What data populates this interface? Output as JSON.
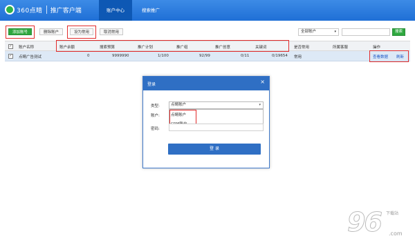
{
  "header": {
    "brand": "360点睛",
    "subtitle": "推广客户端",
    "tabs": [
      {
        "label": "账户中心",
        "active": true
      },
      {
        "label": "搜索推广",
        "active": false
      }
    ]
  },
  "toolbar": {
    "add_account": "添加账号",
    "delete_account": "删除账户",
    "set_common": "设为常用",
    "cancel_common": "取消常用",
    "filter_select": "全部账户",
    "search_value": "",
    "search_button": "搜索"
  },
  "table": {
    "headers": [
      "账户名称",
      "账户余额",
      "搜索预算",
      "推广计划",
      "推广组",
      "推广创意",
      "关键词",
      "是否常用",
      "所属客服",
      "操作"
    ],
    "rows": [
      {
        "checked": true,
        "name": "点睛广告测试",
        "balance": "0",
        "budget": "9999990",
        "plans": "1/100",
        "groups": "92/99",
        "creatives": "0/11",
        "keywords": "0/19654",
        "common": "常用",
        "service": "",
        "action_view": "查看数据",
        "action_refresh": "刷新"
      }
    ]
  },
  "login_dialog": {
    "title": "登录",
    "close": "×",
    "type_label": "类型:",
    "type_value": "点睛账户",
    "options": [
      "点睛账户",
      "CRM账户"
    ],
    "account_label": "账户:",
    "password_label": "密码:",
    "login_button": "登 录"
  },
  "watermark": {
    "number": "96",
    "sub": "下载站",
    "domain": ".com"
  },
  "colors": {
    "header_blue": "#1f6fd6",
    "active_tab": "#0e58b4",
    "green_button": "#2ea83f",
    "highlight_red": "#e12a2a",
    "selected_row": "#dde9f6",
    "link_blue": "#1a55c5"
  }
}
